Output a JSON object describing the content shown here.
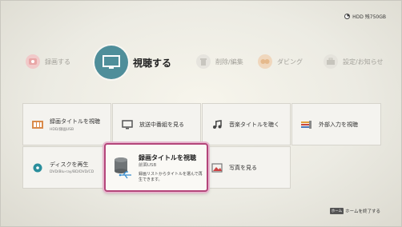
{
  "status": {
    "hdd_label": "HDD 残750GB"
  },
  "menu": {
    "items": [
      {
        "label": "録画する"
      },
      {
        "label": "視聴する"
      },
      {
        "label": "削除/編集"
      },
      {
        "label": "ダビング"
      },
      {
        "label": "設定/お知らせ"
      }
    ]
  },
  "tiles": [
    {
      "label": "録画タイトルを視聴",
      "sub": "HDD/録画USB"
    },
    {
      "label": "放送中番組を見る",
      "sub": ""
    },
    {
      "label": "音楽タイトルを聴く",
      "sub": ""
    },
    {
      "label": "外部入力を視聴",
      "sub": ""
    },
    {
      "label": "ディスクを再生",
      "sub": "DVD/Blu-ray/BD/DVD/CD"
    },
    {
      "label": "写真を見る",
      "sub": ""
    }
  ],
  "selected": {
    "title": "録画タイトルを視聴",
    "sub": "前面USB",
    "description": "録画リストからタイトルを選んで再生できます。"
  },
  "hint": {
    "key": "ホーム",
    "text": "ホームを終了する"
  },
  "colors": {
    "accent": "#4f8e9a",
    "selection": "#b4457a"
  }
}
